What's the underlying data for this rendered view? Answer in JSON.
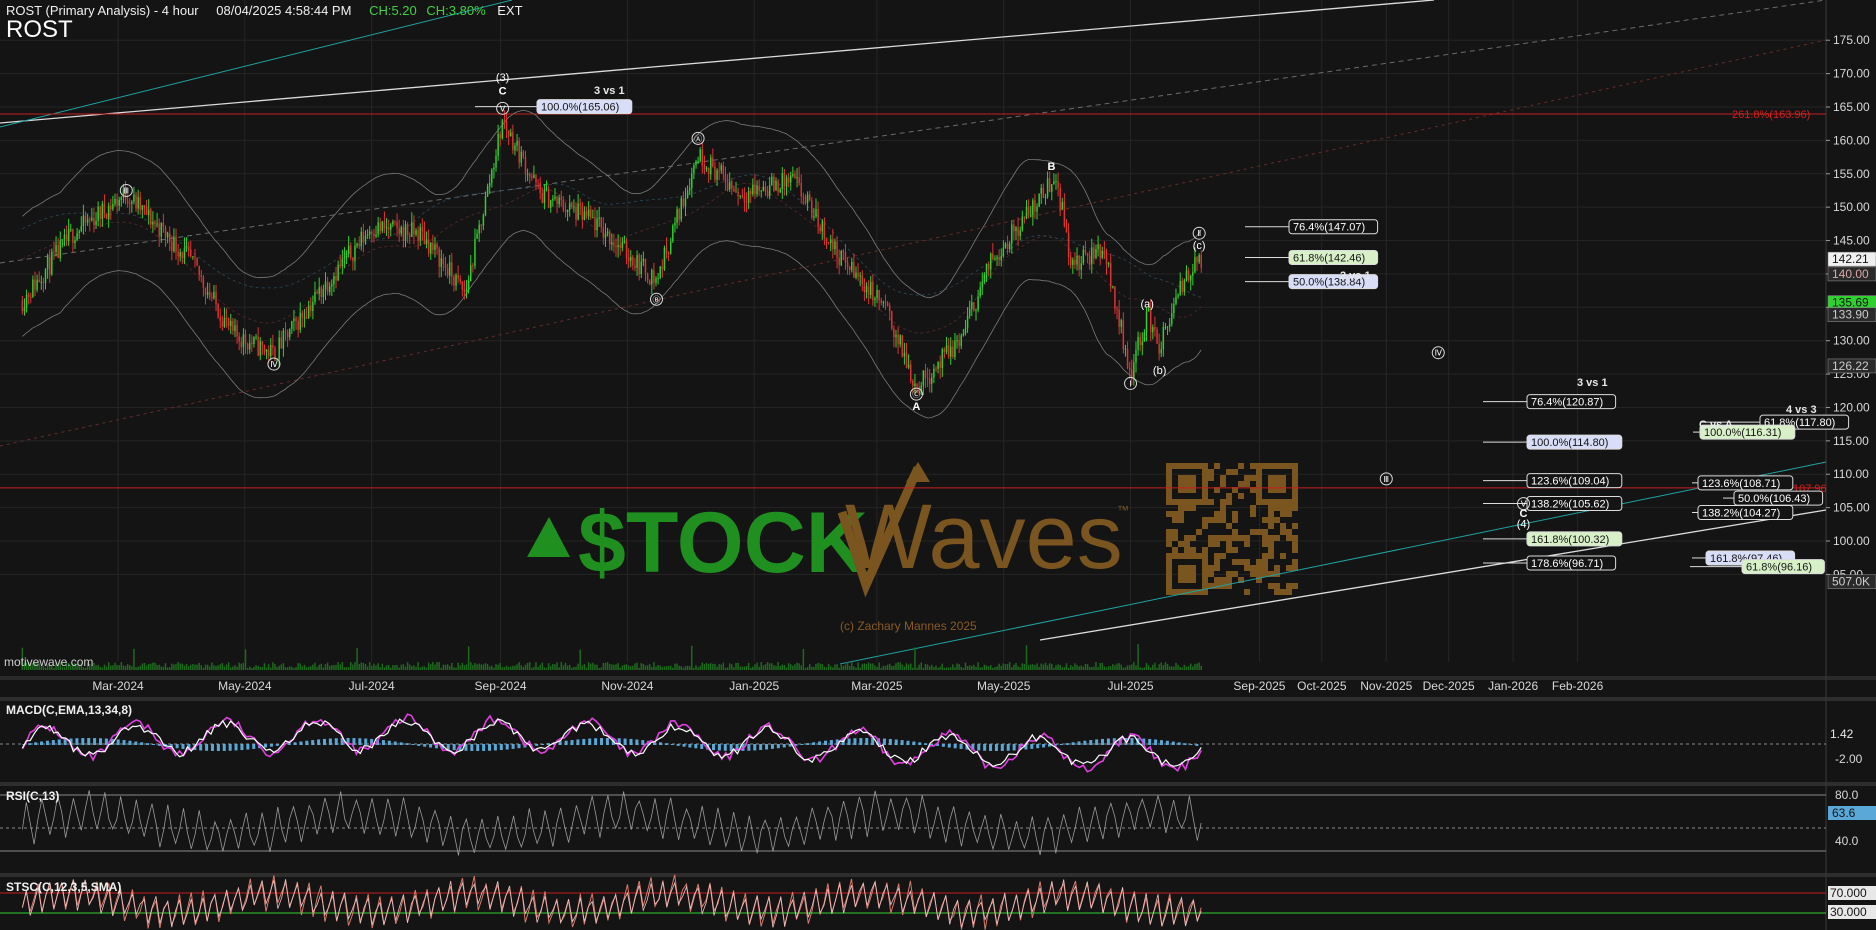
{
  "header": {
    "title": "ROST (Primary Analysis) - 4 hour",
    "datetime": "08/04/2025 4:58:44 PM",
    "change": "CH:5.20",
    "change_pct": "CH:3.80%",
    "session": "EXT",
    "symbol": "ROST"
  },
  "watermark": {
    "text_left": "$TOCK",
    "text_right": "Waves",
    "tm": "™",
    "copyright": "(c) Zachary Mannes 2025",
    "site": "motivewave.com"
  },
  "colors": {
    "up": "#2fd12f",
    "down": "#e03232",
    "background": "#141414",
    "red_line": "#c81e1e",
    "cyan_line": "#1fa3a3",
    "brand_green": "#1f8f1f",
    "brand_brown": "#7a5520"
  },
  "panels": {
    "macd": {
      "label": "MACD(C,EMA,13,34,8)",
      "value": "1.42",
      "lower": "-2.00"
    },
    "rsi": {
      "label": "RSI(C,13)",
      "upper": "80.0",
      "value": "63.6",
      "lower": "40.0"
    },
    "stsc": {
      "label": "STSC(C,12,3,5,SMA)",
      "upper": "70.000",
      "lower": "30.000"
    }
  },
  "chart_data": {
    "type": "candlestick",
    "title": "ROST (Primary Analysis) - 4 hour",
    "x_ticks": [
      "Mar-2024",
      "May-2024",
      "Jul-2024",
      "Sep-2024",
      "Nov-2024",
      "Jan-2025",
      "Mar-2025",
      "May-2025",
      "Jul-2025",
      "Sep-2025",
      "Oct-2025",
      "Nov-2025",
      "Dec-2025",
      "Jan-2026",
      "Feb-2026"
    ],
    "y_ticks": [
      "95.00",
      "100.00",
      "105.00",
      "110.00",
      "115.00",
      "120.00",
      "125.00",
      "130.00",
      "135.00",
      "140.00",
      "145.00",
      "150.00",
      "155.00",
      "160.00",
      "165.00",
      "170.00",
      "175.00"
    ],
    "ylim": [
      92,
      177
    ],
    "price_path": [
      {
        "date": "2024-01-15",
        "price": 136
      },
      {
        "date": "2024-02-08",
        "price": 146
      },
      {
        "date": "2024-03-05",
        "price": 152
      },
      {
        "date": "2024-04-05",
        "price": 142
      },
      {
        "date": "2024-04-25",
        "price": 131
      },
      {
        "date": "2024-05-15",
        "price": 128
      },
      {
        "date": "2024-06-05",
        "price": 137
      },
      {
        "date": "2024-07-01",
        "price": 147
      },
      {
        "date": "2024-07-25",
        "price": 146
      },
      {
        "date": "2024-08-15",
        "price": 137
      },
      {
        "date": "2024-09-02",
        "price": 163
      },
      {
        "date": "2024-09-20",
        "price": 152
      },
      {
        "date": "2024-10-15",
        "price": 148
      },
      {
        "date": "2024-11-15",
        "price": 139
      },
      {
        "date": "2024-12-05",
        "price": 158
      },
      {
        "date": "2024-12-25",
        "price": 152
      },
      {
        "date": "2025-01-20",
        "price": 154
      },
      {
        "date": "2025-02-10",
        "price": 143
      },
      {
        "date": "2025-03-05",
        "price": 135
      },
      {
        "date": "2025-03-20",
        "price": 123
      },
      {
        "date": "2025-04-10",
        "price": 130
      },
      {
        "date": "2025-04-25",
        "price": 142
      },
      {
        "date": "2025-05-20",
        "price": 152
      },
      {
        "date": "2025-05-26",
        "price": 155
      },
      {
        "date": "2025-06-03",
        "price": 141
      },
      {
        "date": "2025-06-18",
        "price": 144
      },
      {
        "date": "2025-07-01",
        "price": 125
      },
      {
        "date": "2025-07-09",
        "price": 134
      },
      {
        "date": "2025-07-15",
        "price": 129
      },
      {
        "date": "2025-07-28",
        "price": 140
      },
      {
        "date": "2025-08-04",
        "price": 142.21
      }
    ],
    "price_tags": [
      {
        "label": "142.21",
        "price": 142.21,
        "color": "#ffffff"
      },
      {
        "label": "140.00",
        "price": 140.0,
        "color": "#d8a8a8"
      },
      {
        "label": "135.69",
        "price": 135.69,
        "color": "#2fd12f"
      },
      {
        "label": "133.90",
        "price": 133.9,
        "color": "#cccccc"
      },
      {
        "label": "126.22",
        "price": 126.22,
        "color": "#cccccc"
      },
      {
        "label": "507.0K",
        "price": 93.9,
        "color": "#cccccc"
      }
    ],
    "wave_labels": [
      {
        "text": "Ⅲ",
        "date": "2024-03-05",
        "price": 152.5
      },
      {
        "text": "Ⅳ",
        "date": "2024-05-15",
        "price": 126.5
      },
      {
        "text": "(3)",
        "date": "2024-09-02",
        "price": 169.5
      },
      {
        "text": "C",
        "date": "2024-09-02",
        "price": 167.5
      },
      {
        "text": "Ⅴ",
        "date": "2024-09-02",
        "price": 164.8
      },
      {
        "text": "Ⓐ",
        "date": "2024-12-05",
        "price": 160.3
      },
      {
        "text": "Ⓑ",
        "date": "2024-11-15",
        "price": 136.2
      },
      {
        "text": "Ⓒ",
        "date": "2025-03-20",
        "price": 122.0
      },
      {
        "text": "A",
        "date": "2025-03-20",
        "price": 120.2
      },
      {
        "text": "B",
        "date": "2025-05-24",
        "price": 156.2
      },
      {
        "text": "Ⅰ",
        "date": "2025-07-01",
        "price": 123.6
      },
      {
        "text": "(a)",
        "date": "2025-07-09",
        "price": 135.6
      },
      {
        "text": "(b)",
        "date": "2025-07-15",
        "price": 125.6
      },
      {
        "text": "Ⅱ",
        "date": "2025-08-03",
        "price": 146.1
      },
      {
        "text": "(c)",
        "date": "2025-08-03",
        "price": 144.3
      },
      {
        "text": "Ⅳ",
        "date": "2025-11-26",
        "price": 128.2
      },
      {
        "text": "Ⅲ",
        "date": "2025-11-01",
        "price": 109.3
      },
      {
        "text": "Ⅴ",
        "date": "2026-01-06",
        "price": 105.6
      },
      {
        "text": "C",
        "date": "2026-01-06",
        "price": 104.2
      },
      {
        "text": "(4)",
        "date": "2026-01-06",
        "price": 102.6
      }
    ],
    "fib_groups": [
      {
        "note": "3 vs 1",
        "levels": [
          {
            "label": "100.0%(165.06)",
            "price": 165.06
          }
        ]
      },
      {
        "note": "2 vs 1",
        "levels": [
          {
            "label": "76.4%(147.07)",
            "price": 147.07
          },
          {
            "label": "61.8%(142.46)",
            "price": 142.46
          },
          {
            "label": "50.0%(138.84)",
            "price": 138.84
          }
        ]
      },
      {
        "note": "3 vs 1",
        "levels": [
          {
            "label": "76.4%(120.87)",
            "price": 120.87
          },
          {
            "label": "100.0%(114.80)",
            "price": 114.8
          },
          {
            "label": "123.6%(109.04)",
            "price": 109.04
          },
          {
            "label": "138.2%(105.62)",
            "price": 105.62
          },
          {
            "label": "161.8%(100.32)",
            "price": 100.32
          },
          {
            "label": "178.6%(96.71)",
            "price": 96.71
          }
        ]
      },
      {
        "note": "4 vs 3",
        "levels": [
          {
            "label": "123.6%(108.71)",
            "price": 108.71
          },
          {
            "label": "138.2%(104.27)",
            "price": 104.27
          },
          {
            "label": "161.8%(97.46)",
            "price": 97.46
          }
        ]
      },
      {
        "note": "C vs A",
        "levels": [
          {
            "label": "61.8%(117.80)",
            "price": 117.8
          },
          {
            "label": "100.0%(116.31)",
            "price": 116.31
          },
          {
            "label": "50.0%(106.43)",
            "price": 106.43
          },
          {
            "label": "61.8%(96.16)",
            "price": 96.16
          }
        ]
      }
    ],
    "red_levels": [
      {
        "label": "261.8%(163.96)",
        "price": 163.96
      },
      {
        "label": "107.96",
        "price": 107.96
      }
    ]
  }
}
